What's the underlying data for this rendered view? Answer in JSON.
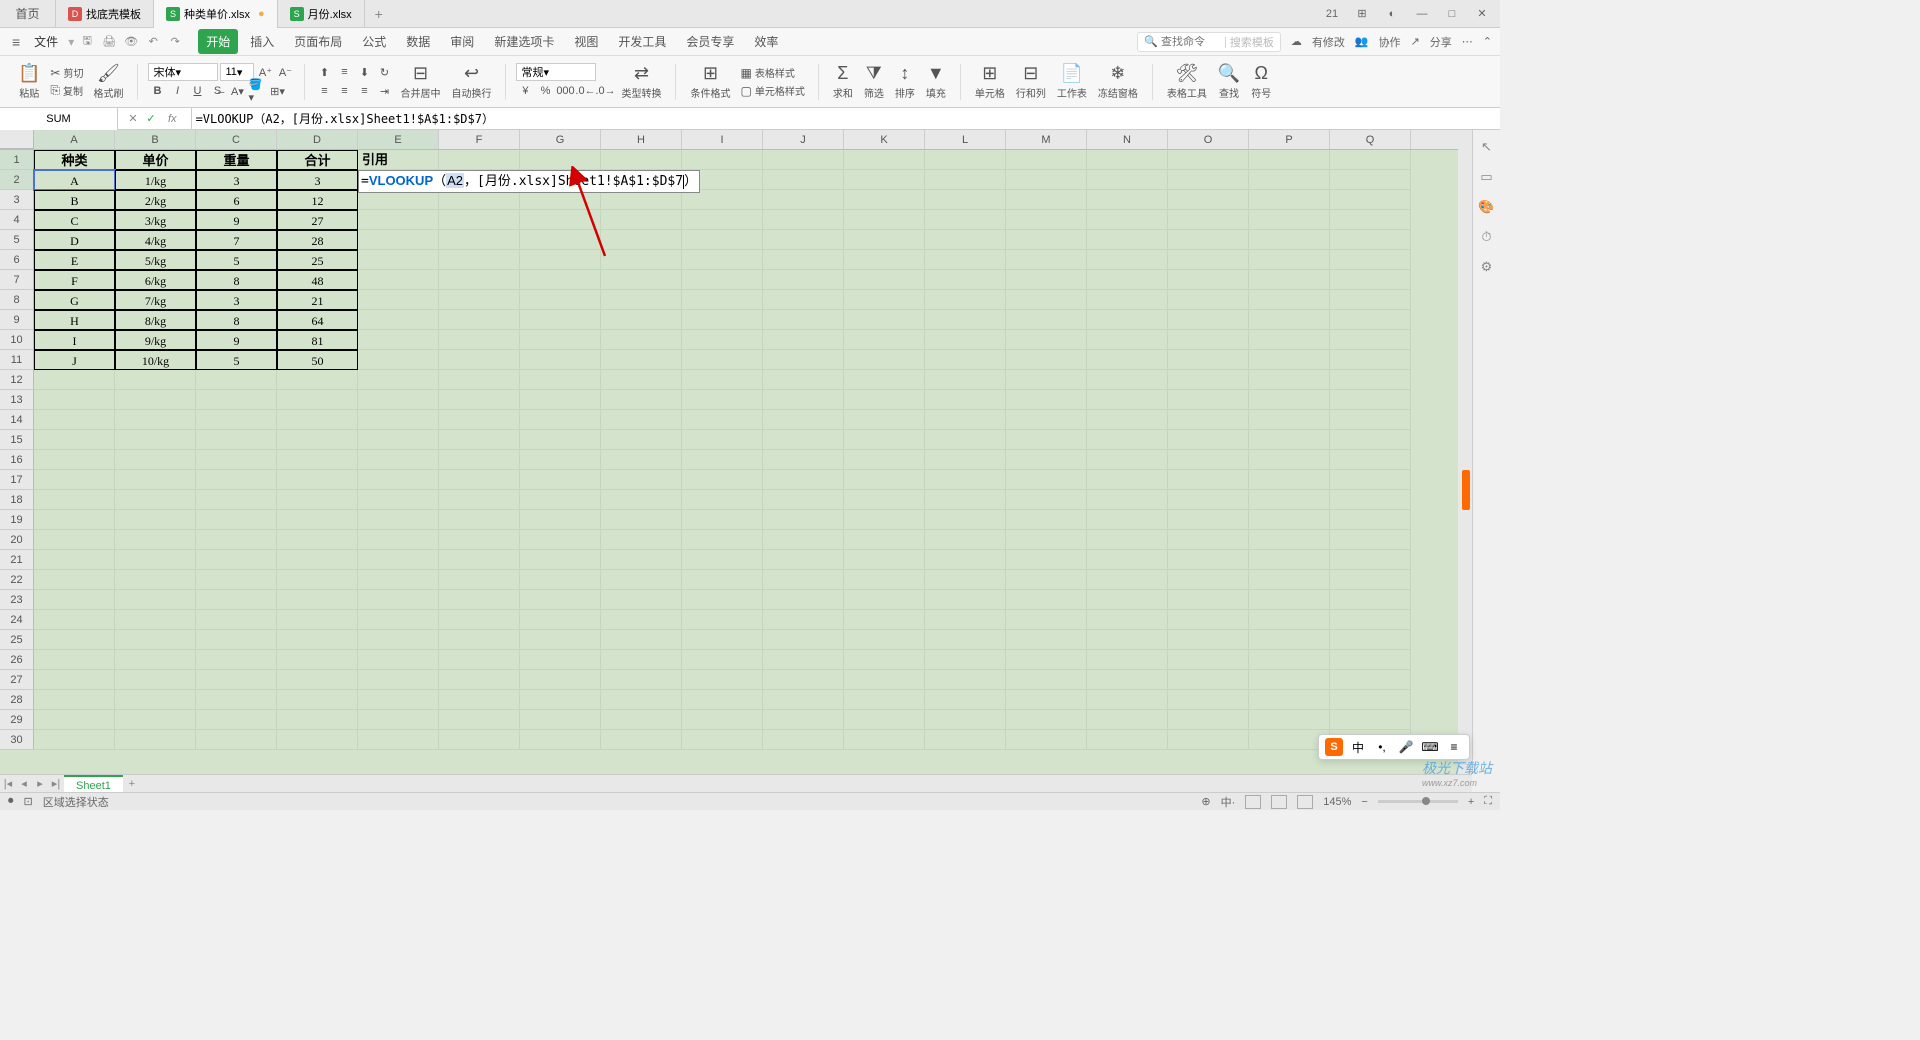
{
  "titlebar": {
    "home": "首页",
    "tabs": [
      {
        "icon": "D",
        "label": "找底壳模板"
      },
      {
        "icon": "S",
        "label": "种类单价.xlsx",
        "active": true,
        "unsaved": "●"
      },
      {
        "icon": "S",
        "label": "月份.xlsx"
      }
    ],
    "add": "+",
    "right_icons": [
      "21",
      "⊞",
      "◐"
    ],
    "win": [
      "—",
      "□",
      "✕"
    ]
  },
  "menubar": {
    "file": "文件",
    "tabs": [
      "开始",
      "插入",
      "页面布局",
      "公式",
      "数据",
      "审阅",
      "新建选项卡",
      "视图",
      "开发工具",
      "会员专享",
      "效率"
    ],
    "active_index": 0,
    "search_hint": "查找命令",
    "search_tpl": "搜索模板",
    "right": {
      "modified": "有修改",
      "collab": "协作",
      "share": "分享"
    }
  },
  "ribbon": {
    "paste": "粘贴",
    "cut": "剪切",
    "copy": "复制",
    "format_painter": "格式刷",
    "font_name": "宋体",
    "font_size": "11",
    "merge": "合并居中",
    "wrap": "自动换行",
    "number_format": "常规",
    "type_convert": "类型转换",
    "cond_fmt": "条件格式",
    "table_style": "表格样式",
    "cell_style": "单元格样式",
    "sum": "求和",
    "filter": "筛选",
    "sort": "排序",
    "fill": "填充",
    "cells": "单元格",
    "rowcol": "行和列",
    "sheet": "工作表",
    "freeze": "冻结窗格",
    "table_tools": "表格工具",
    "find": "查找",
    "symbol": "符号"
  },
  "formula_bar": {
    "name_box": "SUM",
    "formula": "=VLOOKUP（A2，[月份.xlsx]Sheet1!$A$1:$D$7）"
  },
  "columns": [
    "A",
    "B",
    "C",
    "D",
    "E",
    "F",
    "G",
    "H",
    "I",
    "J",
    "K",
    "L",
    "M",
    "N",
    "O",
    "P",
    "Q"
  ],
  "row_count": 30,
  "table": {
    "headers": [
      "种类",
      "单价",
      "重量",
      "合计"
    ],
    "e1": "引用",
    "rows": [
      [
        "A",
        "1/kg",
        "3",
        "3"
      ],
      [
        "B",
        "2/kg",
        "6",
        "12"
      ],
      [
        "C",
        "3/kg",
        "9",
        "27"
      ],
      [
        "D",
        "4/kg",
        "7",
        "28"
      ],
      [
        "E",
        "5/kg",
        "5",
        "25"
      ],
      [
        "F",
        "6/kg",
        "8",
        "48"
      ],
      [
        "G",
        "7/kg",
        "3",
        "21"
      ],
      [
        "H",
        "8/kg",
        "8",
        "64"
      ],
      [
        "I",
        "9/kg",
        "9",
        "81"
      ],
      [
        "J",
        "10/kg",
        "5",
        "50"
      ]
    ]
  },
  "editing_cell": {
    "formula_parts": {
      "prefix": "=",
      "func": "VLOOKUP",
      "open": "（",
      "arg1": "A2",
      "sep": "，",
      "arg2": "[月份.xlsx]Sheet1!$A$1:$D$7",
      "close": "）"
    }
  },
  "sheet_tabs": {
    "sheet1": "Sheet1",
    "add": "+"
  },
  "status": {
    "mode": "区域选择状态",
    "zoom": "145%",
    "ime": {
      "lang": "中",
      "punct": "•,",
      "mic": "🎤",
      "kbd": "⌨"
    }
  },
  "watermark": {
    "main": "极光下载站",
    "sub": "www.xz7.com"
  }
}
